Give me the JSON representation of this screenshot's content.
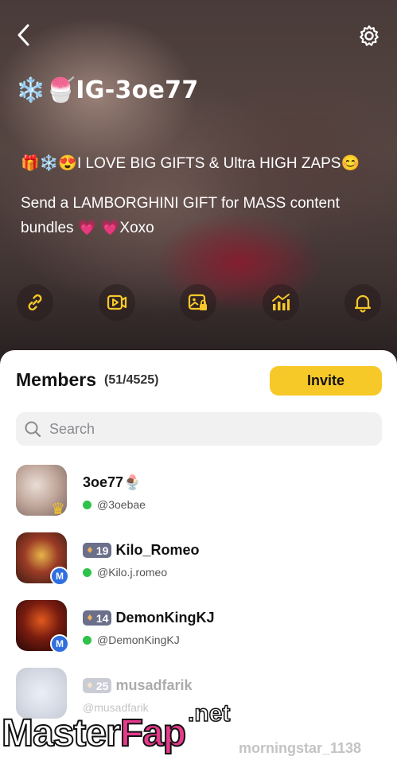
{
  "header": {
    "back_icon": "chevron-left-icon",
    "settings_icon": "gear-icon",
    "title": "❄️🍧IG-3oe77"
  },
  "bio": {
    "line1": "🎁❄️😍I LOVE BIG GIFTS & Ultra HIGH ZAPS😊",
    "line2": "Send a LAMBORGHINI GIFT for MASS content bundles 💗 💗Xoxo"
  },
  "actions": [
    {
      "icon": "link-icon"
    },
    {
      "icon": "video-icon"
    },
    {
      "icon": "locked-photo-icon"
    },
    {
      "icon": "stats-chart-icon"
    },
    {
      "icon": "bell-icon"
    }
  ],
  "members": {
    "title": "Members",
    "count": "(51/4525)",
    "invite_label": "Invite",
    "search_placeholder": "Search",
    "list": [
      {
        "name": "3oe77🍨",
        "handle": "@3oebae",
        "level": "",
        "badge": "crown-icon"
      },
      {
        "name": "Kilo_Romeo",
        "handle": "@Kilo.j.romeo",
        "level": "19",
        "badge": "M"
      },
      {
        "name": "DemonKingKJ",
        "handle": "@DemonKingKJ",
        "level": "14",
        "badge": "M"
      },
      {
        "name": "musadfarik",
        "handle": "@musadfarik",
        "level": "25",
        "badge": ""
      }
    ]
  },
  "accent_color": "#f7c928",
  "watermark": {
    "main": "Master",
    "fap": "Fap",
    "net": ".net",
    "tail": "morningstar_1138"
  }
}
